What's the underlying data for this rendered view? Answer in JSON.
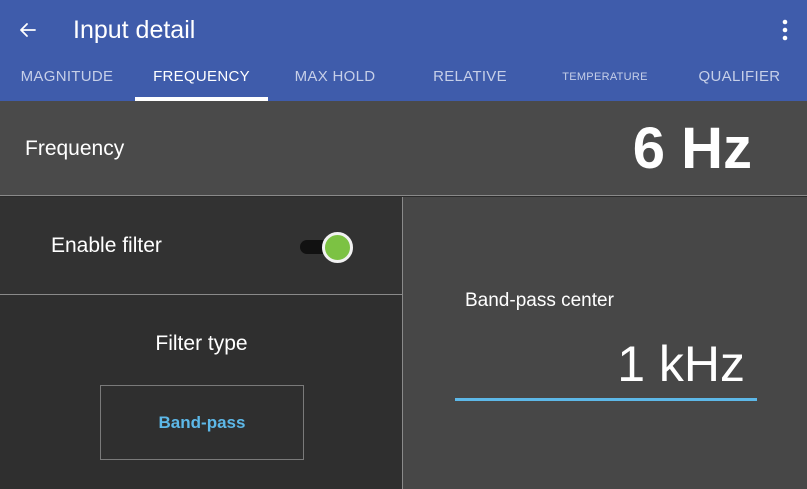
{
  "appbar": {
    "title": "Input detail",
    "back_icon": "arrow-left-icon",
    "menu_icon": "more-vertical-icon",
    "bg_color": "#3f5cab"
  },
  "tabs": [
    {
      "label": "MAGNITUDE",
      "active": false
    },
    {
      "label": "FREQUENCY",
      "active": true
    },
    {
      "label": "MAX HOLD",
      "active": false
    },
    {
      "label": "RELATIVE",
      "active": false
    },
    {
      "label": "TEMPERATURE",
      "active": false
    },
    {
      "label": "QUALIFIER",
      "active": false
    }
  ],
  "frequency": {
    "label": "Frequency",
    "value": "6 Hz"
  },
  "filter": {
    "enable_label": "Enable filter",
    "enabled": true,
    "toggle_color": "#7cc243",
    "type_label": "Filter type",
    "type_value": "Band-pass"
  },
  "bandpass": {
    "label": "Band-pass center",
    "value": "1 kHz",
    "accent_color": "#5db8e8"
  }
}
